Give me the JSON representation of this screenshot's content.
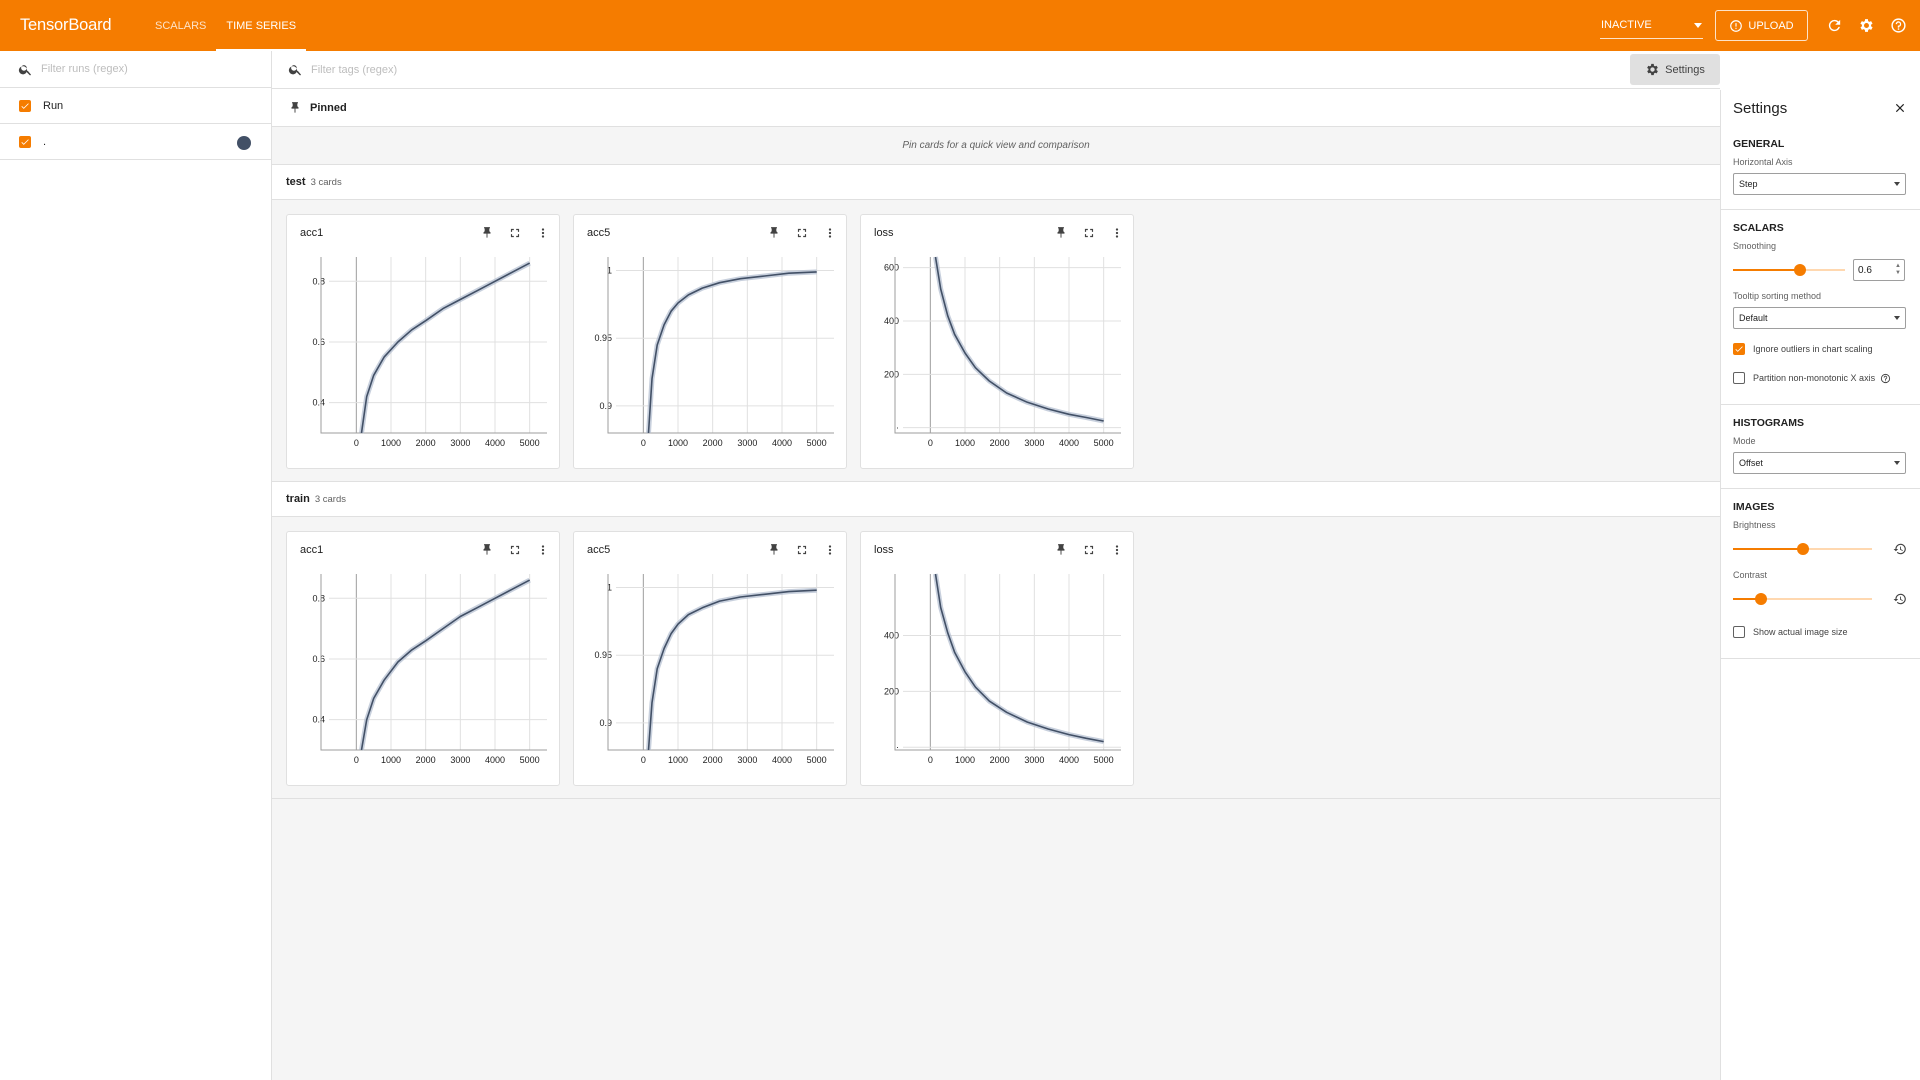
{
  "app": {
    "brand": "TensorBoard",
    "tabs": [
      "SCALARS",
      "TIME SERIES"
    ],
    "active_tab": "TIME SERIES",
    "inactive_select": "INACTIVE",
    "upload_label": "UPLOAD",
    "accent_color": "#f57c00"
  },
  "runs": {
    "filter_placeholder": "Filter runs (regex)",
    "header_label": "Run",
    "items": [
      {
        "name": ".",
        "checked": true,
        "color": "#425066"
      }
    ]
  },
  "main": {
    "tags_placeholder": "Filter tags (regex)",
    "settings_button": "Settings",
    "pinned_label": "Pinned",
    "pinned_empty": "Pin cards for a quick view and comparison"
  },
  "groups": [
    {
      "name": "test",
      "count": "3 cards",
      "cards": [
        {
          "title": "acc1",
          "chart_data": {
            "type": "line",
            "x_ticks": [
              "0",
              "1000",
              "2000",
              "3000",
              "4000",
              "5000"
            ],
            "y_ticks": [
              "0.8",
              "0.6",
              "0.4"
            ],
            "xlim": [
              -500,
              5500
            ],
            "ylim": [
              0.3,
              0.88
            ],
            "series": [
              {
                "x": [
                  150,
                  300,
                  500,
                  800,
                  1200,
                  1600,
                  2000,
                  2500,
                  3000,
                  3500,
                  4000,
                  4500,
                  5000
                ],
                "values": [
                  0.3,
                  0.42,
                  0.49,
                  0.55,
                  0.6,
                  0.64,
                  0.67,
                  0.71,
                  0.74,
                  0.77,
                  0.8,
                  0.83,
                  0.86
                ]
              }
            ]
          }
        },
        {
          "title": "acc5",
          "chart_data": {
            "type": "line",
            "x_ticks": [
              "0",
              "1000",
              "2000",
              "3000",
              "4000",
              "5000"
            ],
            "y_ticks": [
              "1",
              "0.95",
              "0.9"
            ],
            "xlim": [
              -500,
              5500
            ],
            "ylim": [
              0.88,
              1.01
            ],
            "series": [
              {
                "x": [
                  150,
                  250,
                  400,
                  600,
                  800,
                  1000,
                  1300,
                  1700,
                  2200,
                  2800,
                  3500,
                  4200,
                  5000
                ],
                "values": [
                  0.88,
                  0.92,
                  0.945,
                  0.96,
                  0.97,
                  0.976,
                  0.982,
                  0.987,
                  0.991,
                  0.994,
                  0.996,
                  0.998,
                  0.999
                ]
              }
            ]
          }
        },
        {
          "title": "loss",
          "chart_data": {
            "type": "line",
            "x_ticks": [
              "0",
              "1000",
              "2000",
              "3000",
              "4000",
              "5000"
            ],
            "y_ticks": [
              "600",
              "400",
              "200",
              "·"
            ],
            "xlim": [
              -500,
              5500
            ],
            "ylim": [
              -20,
              640
            ],
            "series": [
              {
                "x": [
                  150,
                  300,
                  500,
                  700,
                  1000,
                  1300,
                  1700,
                  2200,
                  2800,
                  3400,
                  4000,
                  4500,
                  5000
                ],
                "values": [
                  640,
                  520,
                  420,
                  350,
                  280,
                  225,
                  175,
                  130,
                  95,
                  70,
                  50,
                  38,
                  25
                ]
              }
            ]
          }
        }
      ]
    },
    {
      "name": "train",
      "count": "3 cards",
      "cards": [
        {
          "title": "acc1",
          "chart_data": {
            "type": "line",
            "x_ticks": [
              "0",
              "1000",
              "2000",
              "3000",
              "4000",
              "5000"
            ],
            "y_ticks": [
              "0.8",
              "0.6",
              "0.4"
            ],
            "xlim": [
              -500,
              5500
            ],
            "ylim": [
              0.3,
              0.88
            ],
            "series": [
              {
                "x": [
                  150,
                  300,
                  500,
                  800,
                  1200,
                  1600,
                  2000,
                  2500,
                  3000,
                  3500,
                  4000,
                  4500,
                  5000
                ],
                "values": [
                  0.3,
                  0.4,
                  0.47,
                  0.53,
                  0.59,
                  0.63,
                  0.66,
                  0.7,
                  0.74,
                  0.77,
                  0.8,
                  0.83,
                  0.86
                ]
              }
            ]
          }
        },
        {
          "title": "acc5",
          "chart_data": {
            "type": "line",
            "x_ticks": [
              "0",
              "1000",
              "2000",
              "3000",
              "4000",
              "5000"
            ],
            "y_ticks": [
              "1",
              "0.95",
              "0.9"
            ],
            "xlim": [
              -500,
              5500
            ],
            "ylim": [
              0.88,
              1.01
            ],
            "series": [
              {
                "x": [
                  150,
                  250,
                  400,
                  600,
                  800,
                  1000,
                  1300,
                  1700,
                  2200,
                  2800,
                  3500,
                  4200,
                  5000
                ],
                "values": [
                  0.88,
                  0.915,
                  0.94,
                  0.955,
                  0.966,
                  0.973,
                  0.98,
                  0.985,
                  0.99,
                  0.993,
                  0.995,
                  0.997,
                  0.998
                ]
              }
            ]
          }
        },
        {
          "title": "loss",
          "chart_data": {
            "type": "line",
            "x_ticks": [
              "0",
              "1000",
              "2000",
              "3000",
              "4000",
              "5000"
            ],
            "y_ticks": [
              "400",
              "200",
              "·"
            ],
            "xlim": [
              -500,
              5500
            ],
            "ylim": [
              -10,
              620
            ],
            "series": [
              {
                "x": [
                  150,
                  300,
                  500,
                  700,
                  1000,
                  1300,
                  1700,
                  2200,
                  2800,
                  3400,
                  4000,
                  4500,
                  5000
                ],
                "values": [
                  620,
                  500,
                  410,
                  340,
                  270,
                  215,
                  165,
                  125,
                  90,
                  65,
                  45,
                  32,
                  20
                ]
              }
            ]
          }
        }
      ]
    }
  ],
  "settings": {
    "title": "Settings",
    "general": {
      "heading": "GENERAL",
      "horizontal_axis_label": "Horizontal Axis",
      "horizontal_axis_value": "Step"
    },
    "scalars": {
      "heading": "SCALARS",
      "smoothing_label": "Smoothing",
      "smoothing_value": "0.6",
      "smoothing_fraction": 0.6,
      "tooltip_label": "Tooltip sorting method",
      "tooltip_value": "Default",
      "ignore_outliers_label": "Ignore outliers in chart scaling",
      "ignore_outliers_checked": true,
      "partition_label": "Partition non-monotonic X axis",
      "partition_checked": false
    },
    "histograms": {
      "heading": "HISTOGRAMS",
      "mode_label": "Mode",
      "mode_value": "Offset"
    },
    "images": {
      "heading": "IMAGES",
      "brightness_label": "Brightness",
      "brightness_fraction": 0.5,
      "contrast_label": "Contrast",
      "contrast_fraction": 0.2,
      "actual_size_label": "Show actual image size",
      "actual_size_checked": false
    }
  }
}
